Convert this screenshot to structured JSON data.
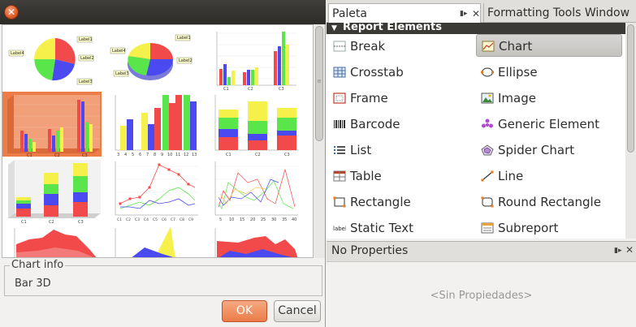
{
  "dialog": {
    "close_glyph": "✕",
    "chart_info_legend": "Chart info",
    "chart_info_value": "Bar 3D",
    "ok_label": "OK",
    "cancel_label": "Cancel",
    "thumbnails": [
      {
        "name": "pie-chart",
        "labels": [
          "Label1",
          "Label2",
          "Label3",
          "Label4"
        ]
      },
      {
        "name": "pie-3d-chart",
        "labels": [
          "Label1",
          "Label2",
          "Label3",
          "Label4"
        ]
      },
      {
        "name": "bar-chart",
        "labels": [
          "C1",
          "C2",
          "C3"
        ]
      },
      {
        "name": "bar-3d-chart",
        "labels": [
          "C1",
          "C2",
          "C3"
        ]
      },
      {
        "name": "xy-bar-chart",
        "labels": [
          "3",
          "4",
          "5",
          "6",
          "7",
          "8",
          "9",
          "10",
          "11",
          "12",
          "13"
        ]
      },
      {
        "name": "stacked-bar-chart",
        "labels": [
          "C1",
          "C2",
          "C3"
        ]
      },
      {
        "name": "stacked-bar-3d-chart",
        "labels": [
          "C1",
          "C2",
          "C3"
        ]
      },
      {
        "name": "line-chart",
        "labels": [
          "C1",
          "C2",
          "C3",
          "C4",
          "C5",
          "C6",
          "C7",
          "C8",
          "C9"
        ]
      },
      {
        "name": "xy-line-chart",
        "labels": [
          "5",
          "10",
          "15",
          "20",
          "25",
          "30",
          "35",
          "40"
        ]
      },
      {
        "name": "area-chart",
        "labels": []
      },
      {
        "name": "stacked-area-chart",
        "labels": []
      },
      {
        "name": "xy-area-chart",
        "labels": []
      }
    ]
  },
  "palette": {
    "tab_paleta": "Paleta",
    "tab_formatting": "Formatting Tools Window",
    "tab_close_glyph": "✕",
    "category": "Report Elements",
    "items": [
      {
        "label": "Break",
        "icon": "break-icon"
      },
      {
        "label": "Chart",
        "icon": "chart-icon",
        "selected": true
      },
      {
        "label": "Crosstab",
        "icon": "crosstab-icon"
      },
      {
        "label": "Ellipse",
        "icon": "ellipse-icon"
      },
      {
        "label": "Frame",
        "icon": "frame-icon"
      },
      {
        "label": "Image",
        "icon": "image-icon"
      },
      {
        "label": "Barcode",
        "icon": "barcode-icon"
      },
      {
        "label": "Generic Element",
        "icon": "generic-element-icon"
      },
      {
        "label": "List",
        "icon": "list-icon"
      },
      {
        "label": "Spider Chart",
        "icon": "spider-chart-icon"
      },
      {
        "label": "Table",
        "icon": "table-icon"
      },
      {
        "label": "Line",
        "icon": "line-icon"
      },
      {
        "label": "Rectangle",
        "icon": "rectangle-icon"
      },
      {
        "label": "Round Rectangle",
        "icon": "round-rectangle-icon"
      },
      {
        "label": "Static Text",
        "icon": "static-text-icon",
        "icon_text": "label"
      },
      {
        "label": "Subreport",
        "icon": "subreport-icon"
      }
    ]
  },
  "properties": {
    "title": "No Properties",
    "empty_text": "<Sin Propiedades>"
  },
  "colors": {
    "accent": "#ec7c48",
    "red": "#f24a4a",
    "blue": "#4a4af0",
    "green": "#5ae64a",
    "yellow": "#f5f04a",
    "selected_bg": "#cccbc8"
  }
}
